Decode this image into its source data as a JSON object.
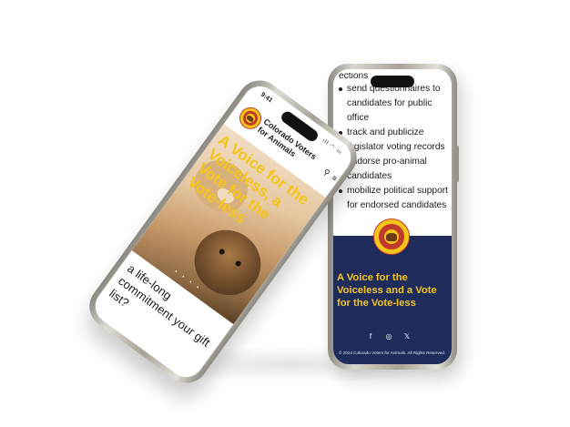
{
  "right_phone": {
    "cut_text": "ections",
    "list_items": [
      "send questionnaires to candidates for public office",
      "track and publicize legislator voting records",
      "endorse pro-animal candidates",
      "mobilize political support for endorsed candidates"
    ],
    "logo_text": "COLORADO VOTERS FOR ANIMALS",
    "tagline": "A Voice for the Voiceless and a Vote for the Vote-less",
    "social_icons": [
      "facebook-icon",
      "instagram-icon",
      "x-icon"
    ],
    "social_glyphs": [
      "f",
      "◎",
      "𝕏"
    ],
    "copyright_mark": "©",
    "copyright": "2024 Colorado Voters for Animals. All Rights Reserved."
  },
  "left_phone": {
    "time": "9:41",
    "status_glyphs": "ıll ◠ ▭",
    "title": "Colorado Voters for Animals",
    "hero_text": "A Voice for the Voiceless, a Vote for the Vote-less",
    "carousel_dots": "• • • •",
    "body_text": "a life-long commitment your gift list?",
    "search_glyph": "⚲",
    "menu_glyph": "≡"
  },
  "colors": {
    "navy": "#1f2b5b",
    "gold": "#f4c61b",
    "red": "#c0392b"
  }
}
